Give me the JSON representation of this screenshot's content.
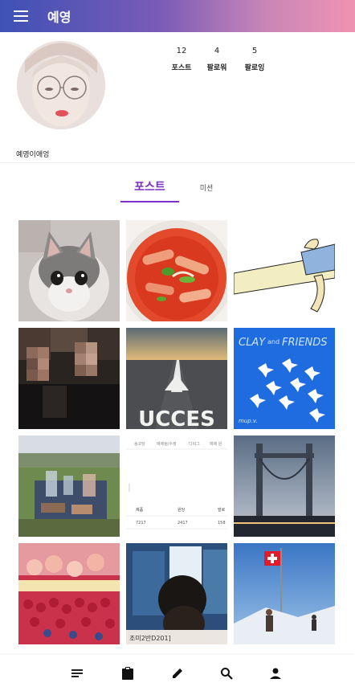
{
  "app": {
    "title": "예영"
  },
  "profile": {
    "username": "예영이애엉",
    "stats": [
      {
        "value": "12",
        "label": "포스트"
      },
      {
        "value": "4",
        "label": "팔로워"
      },
      {
        "value": "5",
        "label": "팔로잉"
      }
    ]
  },
  "tabs": {
    "posts": "포스트",
    "missions": "미션"
  },
  "posts": [
    {
      "subject": "kitten"
    },
    {
      "subject": "tteokbokki"
    },
    {
      "subject": "drawing"
    },
    {
      "subject": "people-pixelated"
    },
    {
      "subject": "road-success",
      "text": "UCCES"
    },
    {
      "subject": "clay-and-friends",
      "text_main": "CLAY",
      "text_and": "and",
      "text_friends": "FRIENDS",
      "text_sig": "mup.v."
    },
    {
      "subject": "picnic"
    },
    {
      "subject": "table-screenshot",
      "tabs": [
        "송코당",
        "예제림/수정",
        "디비그",
        "예제 원"
      ],
      "headers": [
        "제품",
        "원당",
        "발로"
      ],
      "row": [
        "7217",
        "2417",
        "158"
      ]
    },
    {
      "subject": "bridge"
    },
    {
      "subject": "fruit-market"
    },
    {
      "subject": "selfie",
      "caption": "조미2반D201]"
    },
    {
      "subject": "swiss-flag"
    }
  ],
  "nav": [
    "list-icon",
    "clipboard-icon",
    "pencil-icon",
    "search-icon",
    "person-icon"
  ],
  "colors": {
    "accent": "#7b2fc9",
    "appbar_start": "#3f51b5",
    "appbar_end": "#ef93b2"
  }
}
